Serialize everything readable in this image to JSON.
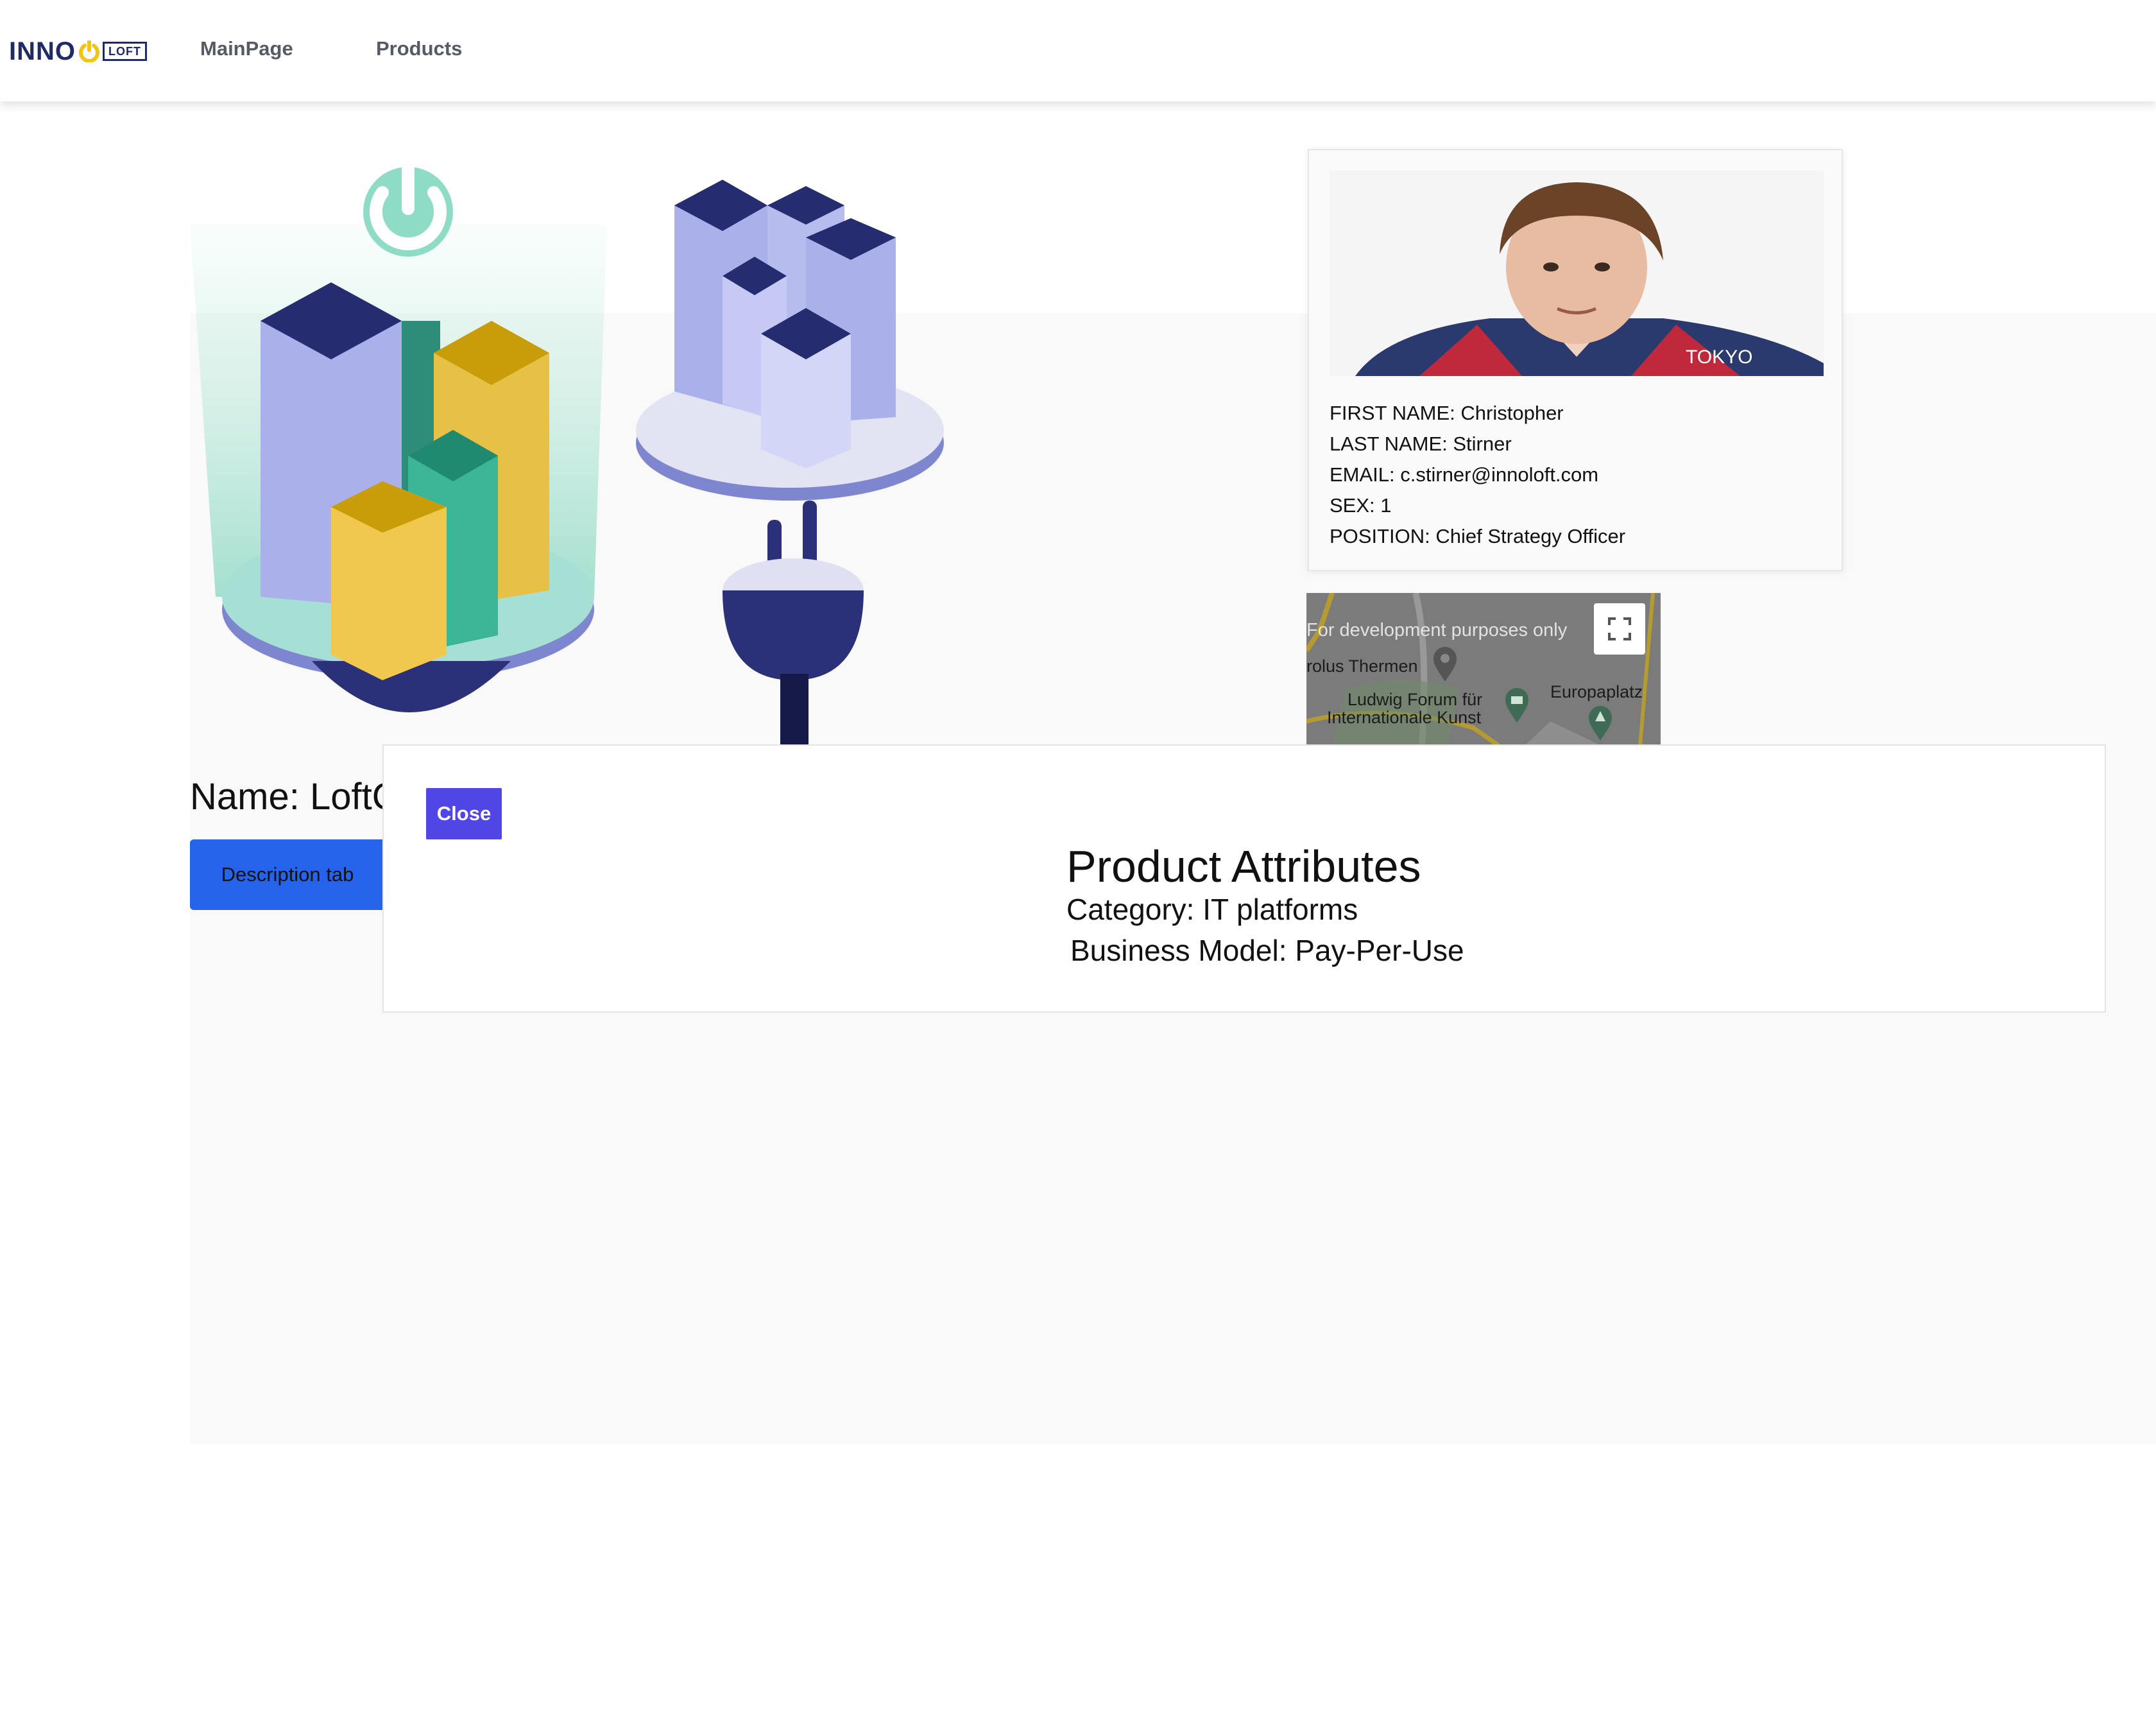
{
  "nav": {
    "logo_inno": "INNO",
    "logo_loft": "LOFT",
    "links": [
      "MainPage",
      "Products"
    ]
  },
  "product": {
    "name": "Name: LoftC",
    "tab_label": "Description tab"
  },
  "user": {
    "first_name": "FIRST NAME: Christopher",
    "last_name": "LAST NAME: Stirner",
    "email": "EMAIL: c.stirner@innoloft.com",
    "sex": "SEX: 1",
    "position": "POSITION: Chief Strategy Officer",
    "shirt_text": "TOKYO"
  },
  "map": {
    "dev_notice": "For development purposes only",
    "places": [
      "rolus Thermen",
      "Ludwig Forum für",
      "Internationale Kunst",
      "Europaplatz"
    ]
  },
  "modal": {
    "close_label": "Close",
    "title": "Product Attributes",
    "category": "Category: IT platforms",
    "business_model": "Business Model: Pay-Per-Use"
  },
  "colors": {
    "brand_navy": "#1f2a6b",
    "brand_yellow": "#f0c419",
    "tab_blue": "#2563eb",
    "close_purple": "#4f46e5"
  }
}
